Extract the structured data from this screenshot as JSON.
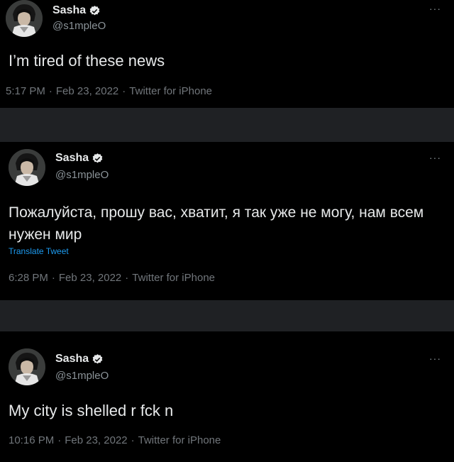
{
  "colors": {
    "background": "#000000",
    "separator": "#1f2124",
    "text": "#e7e9ea",
    "muted": "#71767b",
    "link": "#1d9bf0",
    "verified": "#e7e9ea"
  },
  "tweets": [
    {
      "author": "Sasha",
      "handle": "@s1mpleO",
      "verified_icon": "verified-badge-icon",
      "more_label": "···",
      "text": "I’m tired of these news",
      "translate": "",
      "time": "5:17 PM",
      "date": "Feb 23, 2022",
      "source": "Twitter for iPhone",
      "dot": "·"
    },
    {
      "author": "Sasha",
      "handle": "@s1mpleO",
      "verified_icon": "verified-badge-icon",
      "more_label": "···",
      "text": "Пожалуйста, прошу вас, хватит, я так уже не могу, нам всем нужен мир",
      "translate": "Translate Tweet",
      "time": "6:28 PM",
      "date": "Feb 23, 2022",
      "source": "Twitter for iPhone",
      "dot": "·"
    },
    {
      "author": "Sasha",
      "handle": "@s1mpleO",
      "verified_icon": "verified-badge-icon",
      "more_label": "···",
      "text": "My city is shelled r fck n",
      "translate": "",
      "time": "10:16 PM",
      "date": "Feb 23, 2022",
      "source": "Twitter for iPhone",
      "dot": "·"
    }
  ]
}
